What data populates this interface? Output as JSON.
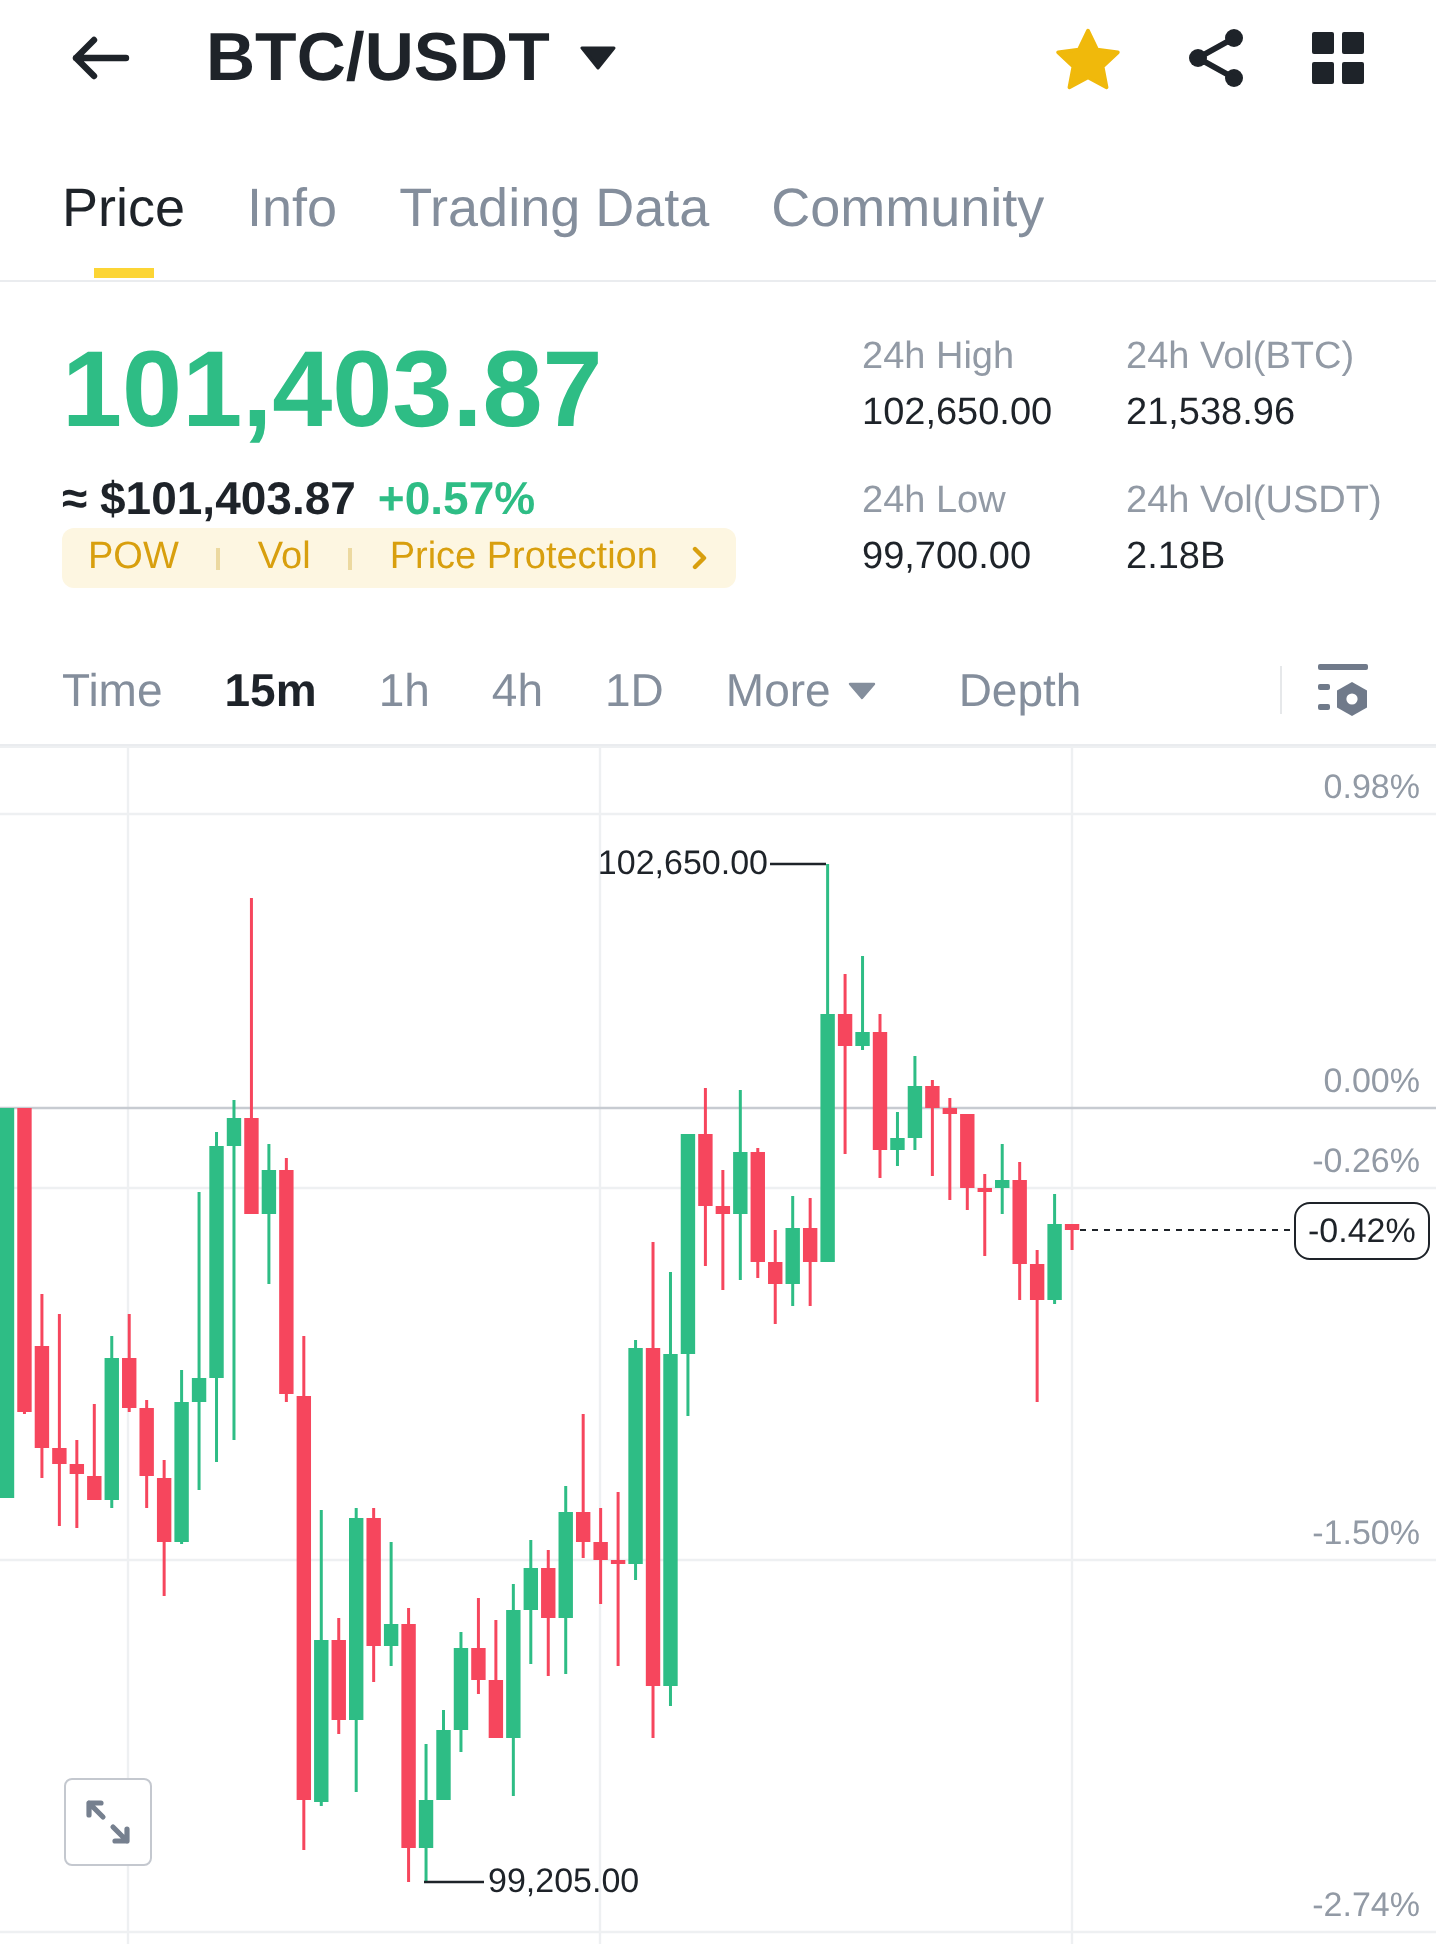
{
  "header": {
    "title": "BTC/USDT",
    "favorite": true
  },
  "tabs": [
    {
      "label": "Price",
      "selected": true
    },
    {
      "label": "Info",
      "selected": false
    },
    {
      "label": "Trading Data",
      "selected": false
    },
    {
      "label": "Community",
      "selected": false
    }
  ],
  "ticker": {
    "last_price": "101,403.87",
    "price_up": true,
    "approx_value": "≈ $101,403.87",
    "change": "+0.57%",
    "tags": [
      "POW",
      "Vol",
      "Price Protection"
    ],
    "stats": [
      {
        "label": "24h High",
        "value": "102,650.00"
      },
      {
        "label": "24h Vol(BTC)",
        "value": "21,538.96"
      },
      {
        "label": "24h Low",
        "value": "99,700.00"
      },
      {
        "label": "24h Vol(USDT)",
        "value": "2.18B"
      }
    ]
  },
  "intervals": [
    {
      "label": "Time",
      "kind": "option",
      "selected": false
    },
    {
      "label": "15m",
      "kind": "option",
      "selected": true
    },
    {
      "label": "1h",
      "kind": "option",
      "selected": false
    },
    {
      "label": "4h",
      "kind": "option",
      "selected": false
    },
    {
      "label": "1D",
      "kind": "option",
      "selected": false
    },
    {
      "label": "More",
      "kind": "dropdown",
      "selected": false
    },
    {
      "label": "Depth",
      "kind": "option",
      "selected": false
    }
  ],
  "chart": {
    "axis_labels": [
      "0.98%",
      "0.00%",
      "-0.26%",
      "-1.50%",
      "-2.74%"
    ],
    "high_label": "102,650.00",
    "low_label": "99,205.00",
    "current_change": "-0.42%"
  }
}
